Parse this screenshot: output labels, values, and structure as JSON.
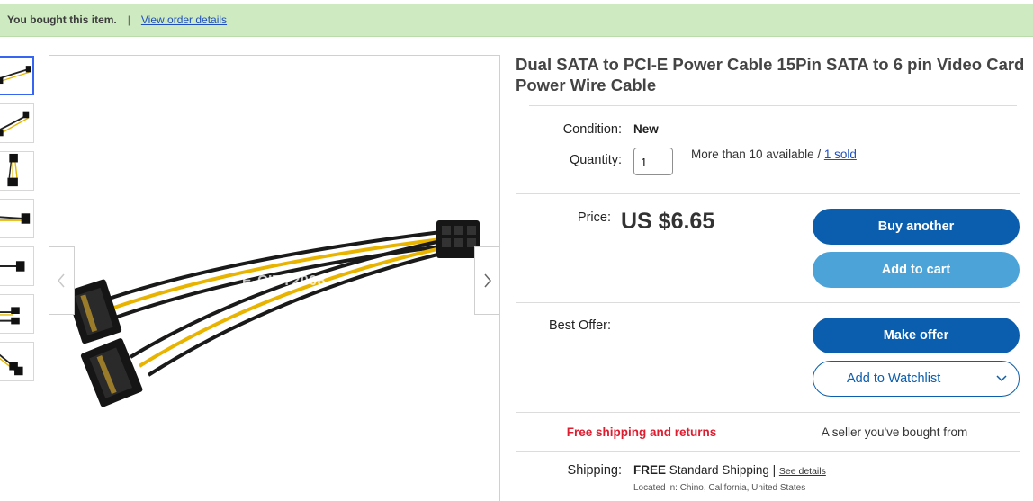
{
  "banner": {
    "bought_text": "You bought this item.",
    "separator": "|",
    "order_link": "View order details"
  },
  "gallery": {
    "thumbnail_count": 7,
    "watermark": "E-CITY2008",
    "prev_icon": "chevron-left-icon",
    "next_icon": "chevron-right-icon"
  },
  "item": {
    "title": "Dual SATA to PCI-E Power Cable 15Pin SATA to 6 pin Video Card Power Wire Cable",
    "condition_label": "Condition:",
    "condition_value": "New",
    "quantity_label": "Quantity:",
    "quantity_value": "1",
    "availability": "More than 10 available / ",
    "sold_link": "1 sold",
    "price_label": "Price:",
    "price": "US $6.65",
    "best_offer_label": "Best Offer:"
  },
  "actions": {
    "buy_another": "Buy another",
    "add_to_cart": "Add to cart",
    "make_offer": "Make offer",
    "add_to_watchlist": "Add to Watchlist",
    "watchlist_dropdown_icon": "chevron-down-icon"
  },
  "shipping": {
    "free_returns": "Free shipping and returns",
    "seller_note": "A seller you've bought from",
    "label": "Shipping:",
    "free": "FREE",
    "method": " Standard Shipping | ",
    "details_link": "See details",
    "location": "Located in: Chino, California, United States"
  },
  "colors": {
    "banner_bg": "#cdeac0",
    "primary_button": "#0b5ead",
    "secondary_button": "#4ba3d8",
    "free_shipping_text": "#dd1e31",
    "link": "#1f4fbf"
  }
}
